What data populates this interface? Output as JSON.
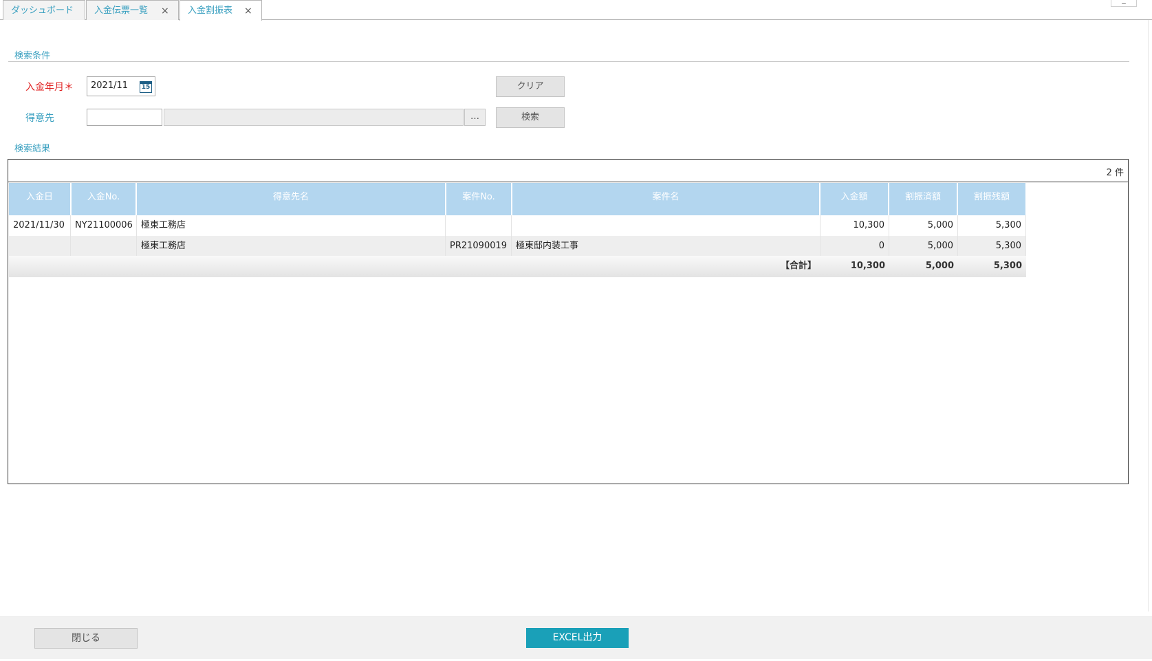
{
  "tabs": [
    {
      "label": "ダッシュボード"
    },
    {
      "label": "入金伝票一覧",
      "close": "×"
    },
    {
      "label": "入金割振表",
      "close": "×"
    }
  ],
  "window": {
    "minimize_label": "_"
  },
  "search": {
    "section_title": "検索条件",
    "year_month_label": "入金年月＊",
    "year_month_value": "2021/11",
    "calendar_icon_text": "15",
    "customer_label": "得意先",
    "customer_code_value": "",
    "customer_name_value": "",
    "lookup_label": "…",
    "clear_label": "クリア",
    "search_label": "検索"
  },
  "results": {
    "section_title": "検索結果",
    "count_text": "2 件",
    "columns": [
      "入金日",
      "入金No.",
      "得意先名",
      "案件No.",
      "案件名",
      "入金額",
      "割振済額",
      "割振残額"
    ],
    "rows": [
      {
        "date": "2021/11/30",
        "payment_no": "NY21100006",
        "customer": "極東工務店",
        "project_no": "",
        "project": "",
        "amount": "10,300",
        "allocated": "5,000",
        "remaining": "5,300"
      },
      {
        "date": "",
        "payment_no": "",
        "customer": "極東工務店",
        "project_no": "PR21090019",
        "project": "極東邸内装工事",
        "amount": "0",
        "allocated": "5,000",
        "remaining": "5,300"
      }
    ],
    "total": {
      "label": "【合計】",
      "amount": "10,300",
      "allocated": "5,000",
      "remaining": "5,300"
    }
  },
  "footer": {
    "close_label": "閉じる",
    "excel_label": "EXCEL出力"
  },
  "colors": {
    "accent": "#3aa0c0",
    "header_bg": "#b3d6ef",
    "required": "#e02020",
    "excel_button": "#1aa0b8"
  }
}
